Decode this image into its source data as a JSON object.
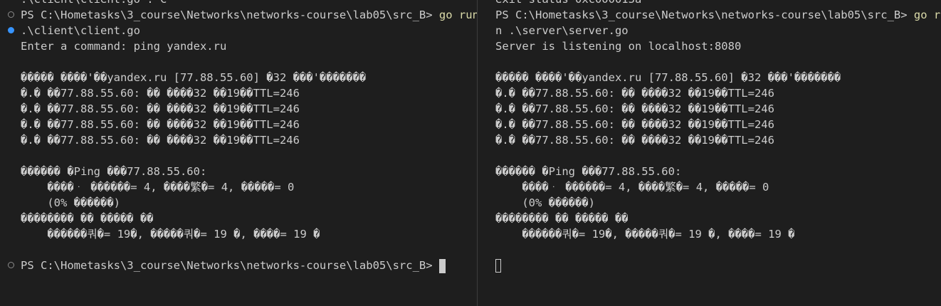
{
  "left_terminal": {
    "lines": [
      {
        "text": ".\\client\\client.go : C",
        "cmd": "",
        "marker": "none"
      },
      {
        "text": "PS C:\\Hometasks\\3_course\\Networks\\networks-course\\lab05\\src_B> ",
        "cmd": "go run",
        "marker": "hollow"
      },
      {
        "text": ".\\client\\client.go",
        "cmd": "",
        "marker": "filled"
      },
      {
        "text": "Enter a command: ping yandex.ru",
        "cmd": "",
        "marker": "none"
      },
      {
        "text": "",
        "cmd": "",
        "marker": "none"
      },
      {
        "text": "����� ����'��yandex.ru [77.88.55.60] �32 ���'�������",
        "cmd": "",
        "marker": "none"
      },
      {
        "text": "�.� ��77.88.55.60: �� ����32 ��19��TTL=246",
        "cmd": "",
        "marker": "none"
      },
      {
        "text": "�.� ��77.88.55.60: �� ����32 ��19��TTL=246",
        "cmd": "",
        "marker": "none"
      },
      {
        "text": "�.� ��77.88.55.60: �� ����32 ��19��TTL=246",
        "cmd": "",
        "marker": "none"
      },
      {
        "text": "�.� ��77.88.55.60: �� ����32 ��19��TTL=246",
        "cmd": "",
        "marker": "none"
      },
      {
        "text": "",
        "cmd": "",
        "marker": "none"
      },
      {
        "text": "������ �Ping ���77.88.55.60:",
        "cmd": "",
        "marker": "none"
      },
      {
        "text": "    ����ᆞ ������= 4, ����繁�= 4, �����= 0",
        "cmd": "",
        "marker": "none"
      },
      {
        "text": "    (0% ������)",
        "cmd": "",
        "marker": "none"
      },
      {
        "text": "�������� �� ����� ��",
        "cmd": "",
        "marker": "none"
      },
      {
        "text": "    ������쿼�= 19�, �����쿼�= 19 �, ����= 19 �",
        "cmd": "",
        "marker": "none"
      },
      {
        "text": "",
        "cmd": "",
        "marker": "none"
      },
      {
        "text": "PS C:\\Hometasks\\3_course\\Networks\\networks-course\\lab05\\src_B> ",
        "cmd": "",
        "marker": "hollow",
        "cursor": "block"
      }
    ]
  },
  "right_terminal": {
    "lines": [
      {
        "text": "exit status 0xc000013a",
        "cmd": "",
        "marker": "none"
      },
      {
        "text": "PS C:\\Hometasks\\3_course\\Networks\\networks-course\\lab05\\src_B> ",
        "cmd": "go ru",
        "marker": "none"
      },
      {
        "text": "n .\\server\\server.go",
        "cmd": "",
        "marker": "none"
      },
      {
        "text": "Server is listening on localhost:8080",
        "cmd": "",
        "marker": "none"
      },
      {
        "text": "",
        "cmd": "",
        "marker": "none"
      },
      {
        "text": "����� ����'��yandex.ru [77.88.55.60] �32 ���'�������",
        "cmd": "",
        "marker": "none"
      },
      {
        "text": "�.� ��77.88.55.60: �� ����32 ��19��TTL=246",
        "cmd": "",
        "marker": "none"
      },
      {
        "text": "�.� ��77.88.55.60: �� ����32 ��19��TTL=246",
        "cmd": "",
        "marker": "none"
      },
      {
        "text": "�.� ��77.88.55.60: �� ����32 ��19��TTL=246",
        "cmd": "",
        "marker": "none"
      },
      {
        "text": "�.� ��77.88.55.60: �� ����32 ��19��TTL=246",
        "cmd": "",
        "marker": "none"
      },
      {
        "text": "",
        "cmd": "",
        "marker": "none"
      },
      {
        "text": "������ �Ping ���77.88.55.60:",
        "cmd": "",
        "marker": "none"
      },
      {
        "text": "    ����ᆞ ������= 4, ����繁�= 4, �����= 0",
        "cmd": "",
        "marker": "none"
      },
      {
        "text": "    (0% ������)",
        "cmd": "",
        "marker": "none"
      },
      {
        "text": "�������� �� ����� ��",
        "cmd": "",
        "marker": "none"
      },
      {
        "text": "    ������쿼�= 19�, �����쿼�= 19 �, ����= 19 �",
        "cmd": "",
        "marker": "none"
      },
      {
        "text": "",
        "cmd": "",
        "marker": "none"
      },
      {
        "text": "",
        "cmd": "",
        "marker": "none",
        "cursor": "hollow"
      }
    ]
  },
  "colors": {
    "background": "#1e1e1e",
    "text": "#cccccc",
    "command": "#dcdcaa",
    "success_marker": "#3794ff",
    "neutral_marker": "#8a8a8a"
  }
}
